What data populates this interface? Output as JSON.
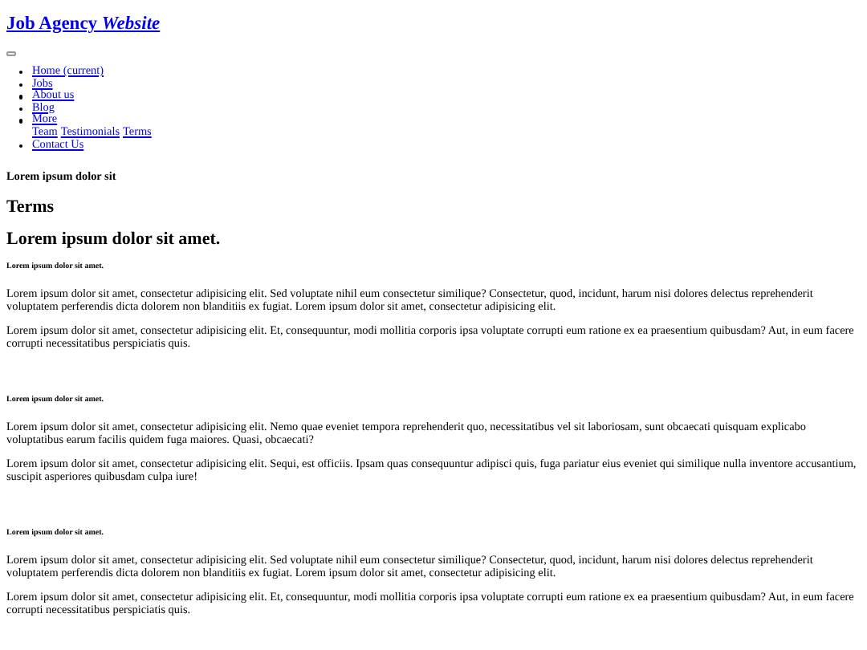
{
  "brand": "Job Agency *Website*",
  "nav": [
    {
      "label": "Home (current)"
    },
    {
      "label": "Jobs"
    },
    {
      "label": "About us"
    },
    {
      "label": "Blog"
    },
    {
      "label": "More",
      "submenu": [
        "Team",
        "Testimonials",
        "Terms"
      ]
    },
    {
      "label": "Contact Us"
    }
  ],
  "kicker": "Lorem ipsum dolor sit",
  "page_title": "Terms",
  "heading": "Lorem ipsum dolor sit amet.",
  "sections": [
    {
      "title": "Lorem ipsum dolor sit amet.",
      "paragraphs": [
        "Lorem ipsum dolor sit amet, consectetur adipisicing elit. Sed voluptate nihil eum consectetur similique? Consectetur, quod, incidunt, harum nisi dolores delectus reprehenderit voluptatem perferendis dicta dolorem non blanditiis ex fugiat. Lorem ipsum dolor sit amet, consectetur adipisicing elit.",
        "Lorem ipsum dolor sit amet, consectetur adipisicing elit. Et, consequuntur, modi mollitia corporis ipsa voluptate corrupti eum ratione ex ea praesentium quibusdam? Aut, in eum facere corrupti necessitatibus perspiciatis quis."
      ]
    },
    {
      "title": "Lorem ipsum dolor sit amet.",
      "paragraphs": [
        "Lorem ipsum dolor sit amet, consectetur adipisicing elit. Nemo quae eveniet tempora reprehenderit quo, necessitatibus vel sit laboriosam, sunt obcaecati quisquam explicabo voluptatibus earum facilis quidem fuga maiores. Quasi, obcaecati?",
        "Lorem ipsum dolor sit amet, consectetur adipisicing elit. Sequi, est officiis. Ipsam quas consequuntur adipisci quis, fuga pariatur eius eveniet qui similique nulla inventore accusantium, suscipit asperiores quibusdam culpa iure!"
      ]
    },
    {
      "title": "Lorem ipsum dolor sit amet.",
      "paragraphs": [
        "Lorem ipsum dolor sit amet, consectetur adipisicing elit. Sed voluptate nihil eum consectetur similique? Consectetur, quod, incidunt, harum nisi dolores delectus reprehenderit voluptatem perferendis dicta dolorem non blanditiis ex fugiat. Lorem ipsum dolor sit amet, consectetur adipisicing elit.",
        "Lorem ipsum dolor sit amet, consectetur adipisicing elit. Et, consequuntur, modi mollitia corporis ipsa voluptate corrupti eum ratione ex ea praesentium quibusdam? Aut, in eum facere corrupti necessitatibus perspiciatis quis."
      ]
    }
  ]
}
